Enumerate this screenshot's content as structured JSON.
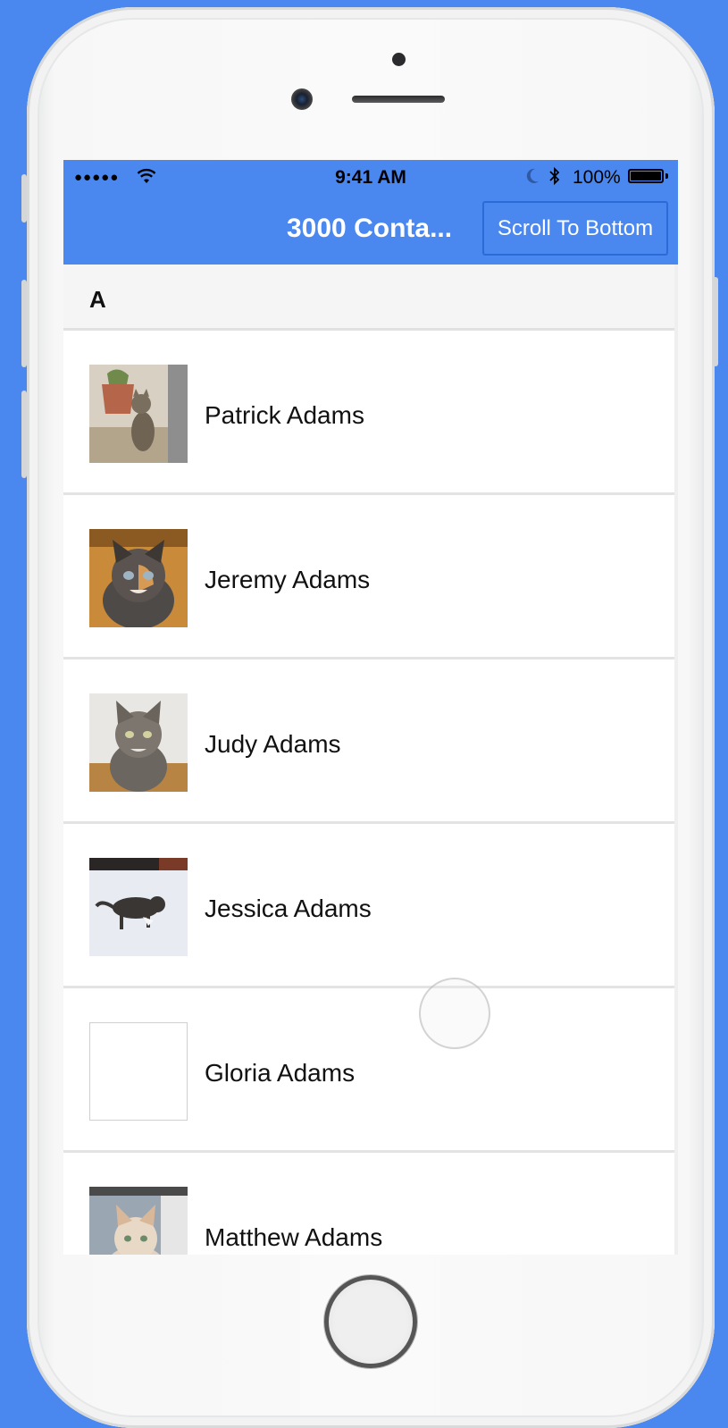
{
  "status_bar": {
    "signal": "●●●●●",
    "time": "9:41 AM",
    "battery": "100%"
  },
  "nav": {
    "title": "3000 Conta...",
    "scroll_button": "Scroll To Bottom"
  },
  "section": {
    "letter": "A"
  },
  "contacts": [
    {
      "name": "Patrick Adams",
      "photo": "kitten-sitting-by-pot"
    },
    {
      "name": "Jeremy Adams",
      "photo": "calico-kitten"
    },
    {
      "name": "Judy Adams",
      "photo": "tabby-kitten"
    },
    {
      "name": "Jessica Adams",
      "photo": "kitten-in-snow"
    },
    {
      "name": "Gloria Adams",
      "photo": ""
    },
    {
      "name": "Matthew Adams",
      "photo": "cream-kitten"
    }
  ],
  "colors": {
    "accent": "#4a87ef",
    "background": "#4a87ef"
  }
}
